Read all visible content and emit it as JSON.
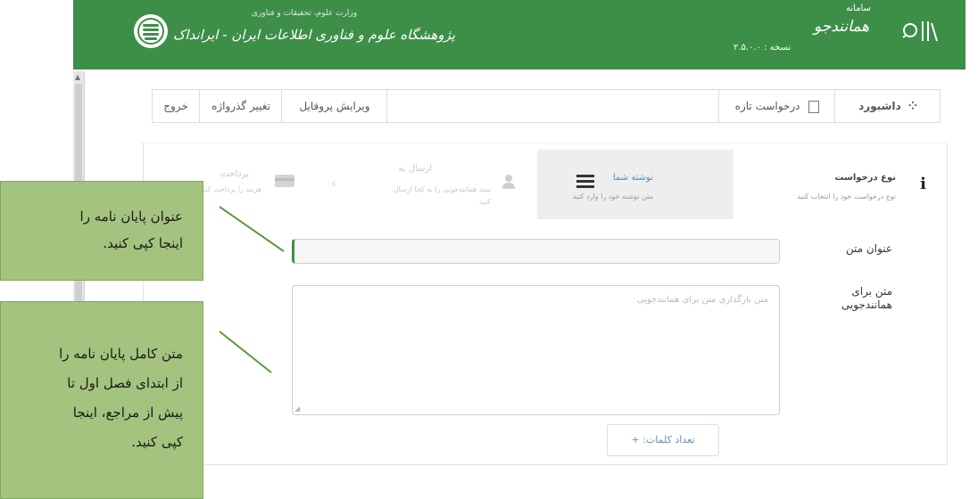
{
  "header": {
    "org_subtitle": "وزارت علوم، تحقیقات و فناوری",
    "org_name": "پژوهشگاه علوم و فناوری اطلاعات ایران - ایرانداک",
    "system_label": "سامانه",
    "system_name": "همانندجو",
    "version": "نسخه : ۲.۵.۰.۰"
  },
  "nav": {
    "items": [
      {
        "label": "خروج"
      },
      {
        "label": "تغییر گذرواژه"
      },
      {
        "label": "ویرایش پروفایل"
      },
      {
        "label": ""
      },
      {
        "label": "درخواست تازه"
      },
      {
        "label": "داشبورد"
      }
    ]
  },
  "steps": [
    {
      "title": "نوع درخواست",
      "desc": "نوع درخواست خود را انتخاب کنید"
    },
    {
      "title": "نوشته شما",
      "desc": "متن نوشته خود را وارد کنید"
    },
    {
      "title": "ارسال به",
      "desc": "سند همانندجویی را به کجا ارسال کنید"
    },
    {
      "title": "پرداخت",
      "desc": "هزینه را پرداخت کنید"
    }
  ],
  "form": {
    "title_label": "عنوان متن",
    "body_label": "متن برای همانندجویی",
    "body_placeholder": "متن بارگذاری متن برای همانندجویی",
    "word_count_button": "تعداد کلمات: +"
  },
  "callouts": {
    "title_hint": [
      "عنوان پایان نامه را",
      "اینجا کپی کنید."
    ],
    "body_hint": [
      "متن کامل پایان نامه را",
      "از ابتدای فصل اول تا",
      "پیش از مراجع، اینجا",
      "کپی کنید."
    ]
  },
  "colors": {
    "header_green": "#3d8f48",
    "callout_green": "#a3c37e",
    "active_step_text": "#4a8fc4"
  },
  "icons": {
    "header_logo": "iran-doc-logo",
    "header_search": "search-books-icon",
    "dashboard": "dashboard-icon",
    "new_request": "document-icon",
    "step1": "info-icon",
    "step2": "menu-lines-icon",
    "step3": "user-icon",
    "step4": "credit-card-icon"
  }
}
